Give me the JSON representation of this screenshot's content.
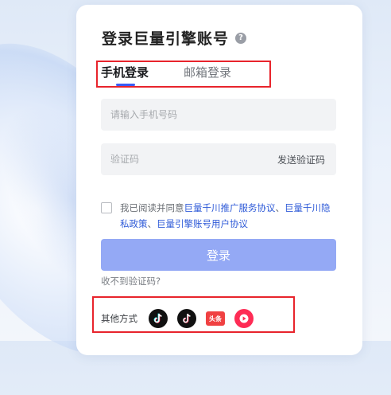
{
  "login": {
    "title": "登录巨量引擎账号",
    "help_icon": "question-circle-icon",
    "tabs": [
      {
        "label": "手机登录",
        "active": true
      },
      {
        "label": "邮箱登录",
        "active": false
      }
    ],
    "phone_placeholder": "请输入手机号码",
    "code_placeholder": "验证码",
    "send_code_label": "发送验证码",
    "agreement": {
      "prefix": "我已阅读并同意",
      "link1": "巨量千川推广服务协议",
      "sep1": "、",
      "link2": "巨量千川隐私政策",
      "sep2": "、",
      "link3": "巨量引擎账号用户协议"
    },
    "login_button": "登录",
    "no_code_link": "收不到验证码?",
    "other_methods_label": "其他方式",
    "other_methods": [
      "douyin-icon",
      "douyin-lite-icon",
      "toutiao-icon",
      "xigua-video-icon"
    ],
    "toutiao_text": "头条"
  },
  "colors": {
    "accent": "#3a5cf5",
    "button": "#94a9f5",
    "link": "#2f5bd8",
    "highlight_box": "#e8242c"
  }
}
